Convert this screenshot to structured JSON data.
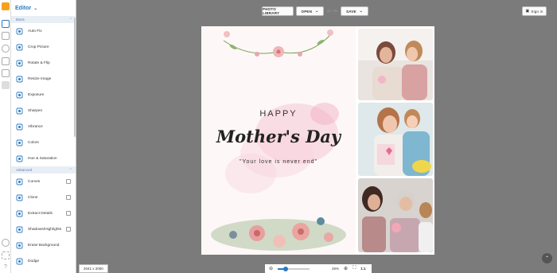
{
  "app": {
    "title": "Editor"
  },
  "sections": {
    "basic": "Basic",
    "advanced": "Advanced"
  },
  "basic_items": [
    {
      "label": "Auto Fix",
      "icon": "magic-wand-icon"
    },
    {
      "label": "Crop Picture",
      "icon": "crop-icon"
    },
    {
      "label": "Rotate & Flip",
      "icon": "rotate-icon"
    },
    {
      "label": "Resize Image",
      "icon": "resize-icon"
    },
    {
      "label": "Exposure",
      "icon": "exposure-icon"
    },
    {
      "label": "Sharpen",
      "icon": "sharpen-icon"
    },
    {
      "label": "Vibrance",
      "icon": "vibrance-icon"
    },
    {
      "label": "Colors",
      "icon": "colors-icon"
    },
    {
      "label": "Hue & Saturation",
      "icon": "hue-icon"
    }
  ],
  "advanced_items": [
    {
      "label": "Curves",
      "icon": "curves-icon"
    },
    {
      "label": "Clone",
      "icon": "clone-icon"
    },
    {
      "label": "Extract Details",
      "icon": "extract-icon"
    },
    {
      "label": "Shadows/Highlights",
      "icon": "shadows-icon"
    },
    {
      "label": "Erase Background",
      "icon": "erase-icon"
    },
    {
      "label": "Dodge",
      "icon": "dodge-icon"
    }
  ],
  "toolbar": {
    "photo_library": "PHOTO LIBRARY",
    "open": "OPEN",
    "save": "SAVE",
    "go": "go",
    "redo_label": "Re",
    "sign_in": "Sign in"
  },
  "poster": {
    "happy": "HAPPY",
    "title": "Mother's Day",
    "quote": "\"Your love is never end\""
  },
  "status": {
    "dimensions": "2041 x 2000",
    "zoom": "26%",
    "zoom_level": 0.26,
    "one_to_one": "1:1"
  },
  "colors": {
    "accent": "#2b78c2",
    "workspace": "#7b7b7b"
  }
}
